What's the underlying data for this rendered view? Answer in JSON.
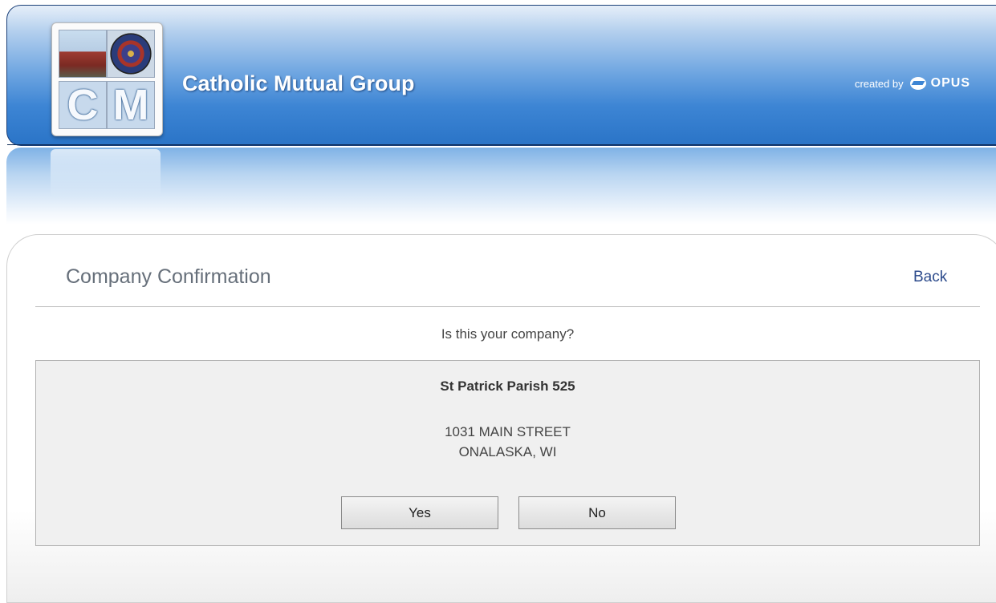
{
  "header": {
    "logo_letters": [
      "C",
      "M"
    ],
    "title": "Catholic Mutual Group",
    "credit_prefix": "created by",
    "credit_brand": "OPUS"
  },
  "page": {
    "heading": "Company Confirmation",
    "back_label": "Back",
    "question": "Is this your company?"
  },
  "company": {
    "name": "St Patrick Parish 525",
    "address_line1": "1031 MAIN STREET",
    "address_line2": "ONALASKA, WI"
  },
  "actions": {
    "yes_label": "Yes",
    "no_label": "No"
  },
  "colors": {
    "header_blue": "#2a74c7",
    "link": "#2d4b8c",
    "heading_text": "#666f7a",
    "box_bg": "#f0f0f0"
  }
}
